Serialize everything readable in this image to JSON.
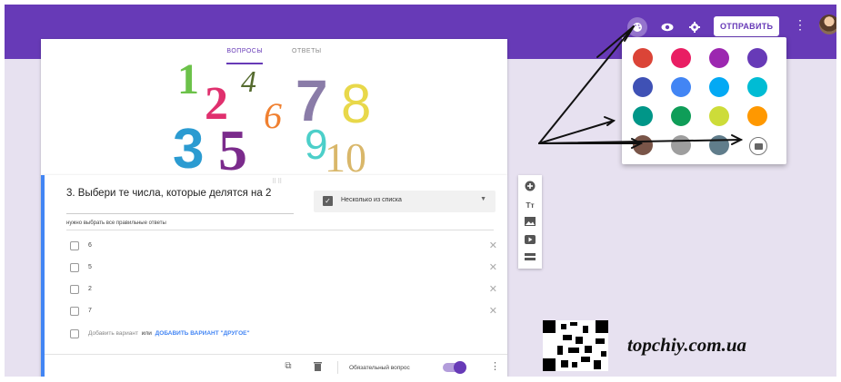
{
  "topbar": {
    "send_label": "ОТПРАВИТЬ",
    "color": "#673ab7"
  },
  "tabs": [
    {
      "label": "ВОПРОСЫ",
      "active": true
    },
    {
      "label": "ОТВЕТЫ",
      "active": false
    }
  ],
  "header_image": {
    "numbers": [
      "1",
      "2",
      "3",
      "4",
      "5",
      "6",
      "7",
      "8",
      "9",
      "10"
    ]
  },
  "question": {
    "title": "3. Выбери те числа, которые делятся на 2",
    "description": "нужно выбрать все правильные ответы",
    "type_label": "Несколько из списка",
    "options": [
      "6",
      "5",
      "2",
      "7"
    ],
    "add_option": "Добавить вариант",
    "add_or": "или",
    "add_other": "ДОБАВИТЬ ВАРИАНТ \"ДРУГОЕ\"",
    "required_label": "Обязательный вопрос",
    "required": true
  },
  "side_toolbar": {
    "icons": [
      "add-question-icon",
      "add-title-icon",
      "add-image-icon",
      "add-video-icon",
      "add-section-icon"
    ],
    "title_glyph": "Tт"
  },
  "palette": {
    "colors": [
      "#db4437",
      "#e91e63",
      "#9c27b0",
      "#673ab7",
      "#3f51b5",
      "#4285f4",
      "#03a9f4",
      "#00bcd4",
      "#009688",
      "#0f9d58",
      "#cddc39",
      "#ff9800",
      "#795548",
      "#9e9e9e",
      "#607d8b"
    ]
  },
  "watermark": "topchiy.com.ua"
}
